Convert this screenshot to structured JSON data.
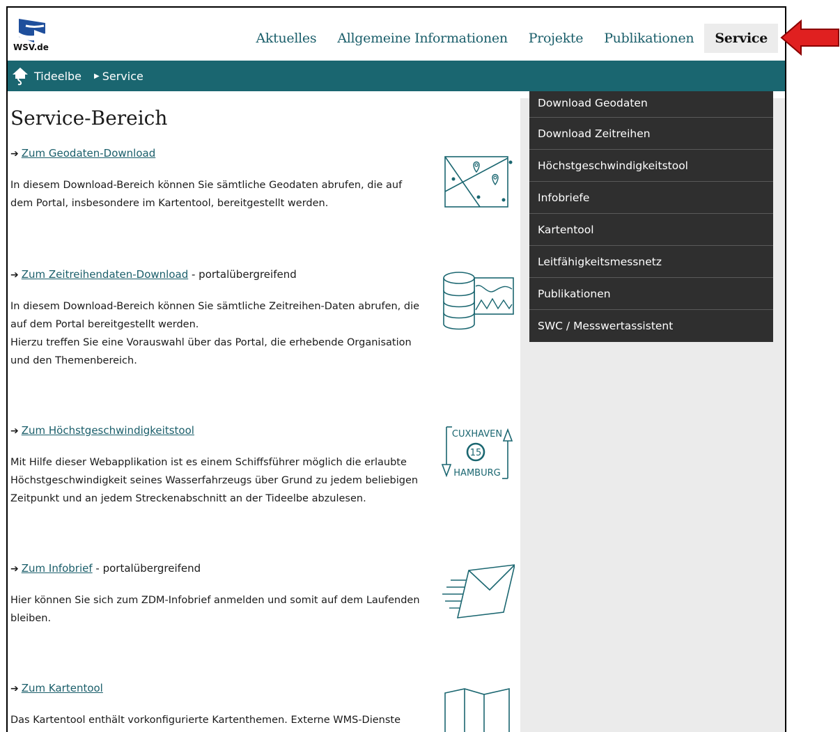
{
  "logo": {
    "text": "WSV.de"
  },
  "topnav": [
    {
      "label": "Aktuelles",
      "active": false
    },
    {
      "label": "Allgemeine Informationen",
      "active": false
    },
    {
      "label": "Projekte",
      "active": false
    },
    {
      "label": "Publikationen",
      "active": false
    },
    {
      "label": "Service",
      "active": true
    }
  ],
  "breadcrumb": {
    "items": [
      "Tideelbe",
      "Service"
    ]
  },
  "page_title": "Service-Bereich",
  "sections": [
    {
      "link": "Zum Geodaten-Download",
      "suffix": "",
      "text": "In diesem Download-Bereich können Sie sämtliche Geodaten abrufen, die auf dem Portal, insbesondere im Kartentool, bereitgestellt werden.",
      "icon": "map-pins-icon"
    },
    {
      "link": "Zum Zeitreihendaten-Download",
      "suffix": " - portalübergreifend",
      "text": "In diesem Download-Bereich können Sie sämtliche Zeitreihen-Daten abrufen, die auf dem Portal bereitgestellt werden.\nHierzu treffen Sie eine Vorauswahl über das Portal, die erhebende Organisation und den Themenbereich.",
      "icon": "database-chart-icon"
    },
    {
      "link": "Zum Höchstgeschwindigkeitstool",
      "suffix": "",
      "text": "Mit Hilfe dieser Webapplikation ist es einem Schiffsführer möglich die erlaubte Höchstgeschwindigkeit seines Wasserfahrzeugs über Grund zu jedem beliebigen Zeitpunkt und an jedem Streckenabschnitt an der Tideelbe abzulesen.",
      "icon": "speed-sign-icon",
      "icon_labels": {
        "top": "CUXHAVEN",
        "speed": "15",
        "bottom": "HAMBURG"
      }
    },
    {
      "link": "Zum Infobrief",
      "suffix": " - portalübergreifend",
      "text": "Hier können Sie sich zum ZDM-Infobrief anmelden und somit auf dem Laufenden bleiben.",
      "icon": "envelope-icon"
    },
    {
      "link": "Zum Kartentool",
      "suffix": "",
      "text": "Das Kartentool enthält vorkonfigurierte Kartenthemen. Externe WMS-Dienste kön-nen dazugeladen werden.",
      "icon": "folded-map-icon"
    }
  ],
  "sidebar": [
    "Download Geodaten",
    "Download Zeitreihen",
    "Höchstgeschwindigkeitstool",
    "Infobriefe",
    "Kartentool",
    "Leitfähigkeitsmessnetz",
    "Publikationen",
    "SWC / Messwertassistent"
  ],
  "colors": {
    "accent": "#1a6670",
    "link": "#1a5e6a",
    "sidebar_bg": "#2f2f2f",
    "annotation_arrow": "#e02020"
  }
}
